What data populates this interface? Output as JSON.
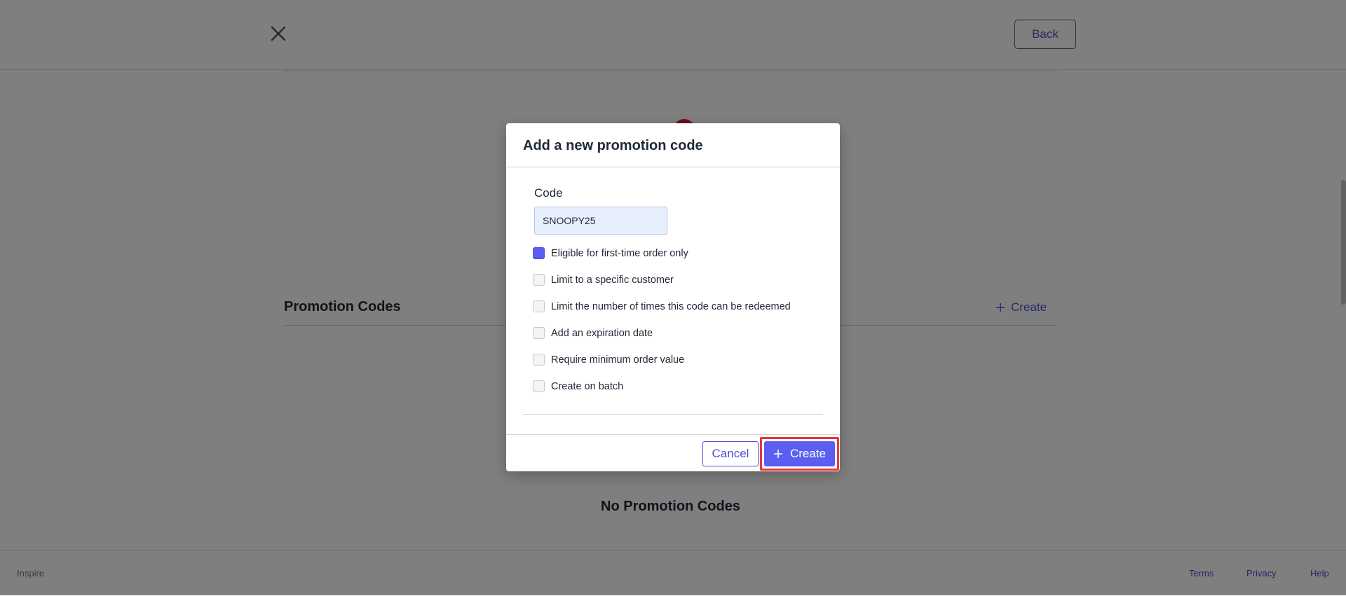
{
  "header": {
    "back_label": "Back"
  },
  "page": {
    "section_title": "Promotion Codes",
    "section_create_label": "Create",
    "empty_title": "No Promotion Codes"
  },
  "footer": {
    "brand": "Inspire",
    "links": [
      "Terms",
      "Privacy",
      "Help"
    ]
  },
  "modal": {
    "title": "Add a new promotion code",
    "code_label": "Code",
    "code_value": "SNOOPY25",
    "options": [
      {
        "label": "Eligible for first-time order only",
        "checked": true
      },
      {
        "label": "Limit to a specific customer",
        "checked": false
      },
      {
        "label": "Limit the number of times this code can be redeemed",
        "checked": false
      },
      {
        "label": "Add an expiration date",
        "checked": false
      },
      {
        "label": "Require minimum order value",
        "checked": false
      },
      {
        "label": "Create on batch",
        "checked": false
      }
    ],
    "cancel_label": "Cancel",
    "create_label": "Create"
  },
  "colors": {
    "accent": "#5b5ef0",
    "link": "#4b4fd9",
    "highlight": "#e53935",
    "overlay": "rgba(0,0,0,0.5)"
  },
  "icons": [
    "close-icon",
    "plus-icon",
    "promo-illustration"
  ]
}
